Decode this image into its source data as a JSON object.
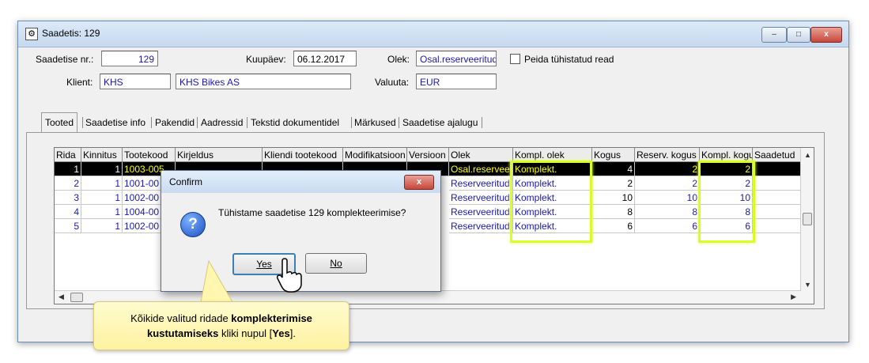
{
  "window": {
    "title": "Saadetis: 129",
    "controls": {
      "minimize": "–",
      "maximize": "□",
      "close": "x"
    }
  },
  "form": {
    "saadetise_nr_label": "Saadetise nr.:",
    "saadetise_nr_value": "129",
    "kuupaev_label": "Kuupäev:",
    "kuupaev_value": "06.12.2017",
    "olek_label": "Olek:",
    "olek_value": "Osal.reserveeritud",
    "peida_label": "Peida tühistatud read",
    "klient_label": "Klient:",
    "klient_code": "KHS",
    "klient_name": "KHS Bikes AS",
    "valuuta_label": "Valuuta:",
    "valuuta_value": "EUR"
  },
  "tabs": [
    {
      "label": "Tooted",
      "active": true
    },
    {
      "label": "Saadetise info"
    },
    {
      "label": "Pakendid"
    },
    {
      "label": "Aadressid"
    },
    {
      "label": "Tekstid dokumentidel"
    },
    {
      "label": "Märkused"
    },
    {
      "label": "Saadetise ajalugu"
    }
  ],
  "grid": {
    "columns": [
      "Rida",
      "Kinnitus",
      "Tootekood",
      "Kirjeldus",
      "Kliendi tootekood",
      "Modifikatsioon",
      "Versioon",
      "Olek",
      "Kompl. olek",
      "Kogus",
      "Reserv. kogus",
      "Kompl. kogu",
      "Saadetud"
    ],
    "rows": [
      {
        "rida": "1",
        "kinnitus": "1",
        "tootekood": "1003-005",
        "olek": "Osal.reserveeri",
        "kompl_olek": "Komplekt.",
        "kogus": "4",
        "reserv": "2",
        "kompl": "2",
        "selected": true
      },
      {
        "rida": "2",
        "kinnitus": "1",
        "tootekood": "1001-00",
        "olek": "Reserveeritud",
        "kompl_olek": "Komplekt.",
        "kogus": "2",
        "reserv": "2",
        "kompl": "2"
      },
      {
        "rida": "3",
        "kinnitus": "1",
        "tootekood": "1002-00",
        "olek": "Reserveeritud",
        "kompl_olek": "Komplekt.",
        "kogus": "10",
        "reserv": "10",
        "kompl": "10"
      },
      {
        "rida": "4",
        "kinnitus": "1",
        "tootekood": "1004-00",
        "olek": "Reserveeritud",
        "kompl_olek": "Komplekt.",
        "kogus": "8",
        "reserv": "8",
        "kompl": "8"
      },
      {
        "rida": "5",
        "kinnitus": "1",
        "tootekood": "1002-00",
        "olek": "Reserveeritud",
        "kompl_olek": "Komplekt.",
        "kogus": "6",
        "reserv": "6",
        "kompl": "6"
      }
    ]
  },
  "dialog": {
    "title": "Confirm",
    "close": "x",
    "message": "Tühistame saadetise 129 komplekteerimise?",
    "icon": "question-icon",
    "yes_label": "Yes",
    "no_label": "No"
  },
  "callout": {
    "text_1": "Kõikide valitud ridade ",
    "bold_1": "komplekterimise",
    "bold_2": "kustutamiseks",
    "text_2": " kliki nupul [",
    "bold_3": "Yes",
    "text_3": "]."
  },
  "colors": {
    "highlight": "#d6ff2a",
    "value_blue": "#1a1ab0",
    "selected_yellow": "#ffff00"
  }
}
